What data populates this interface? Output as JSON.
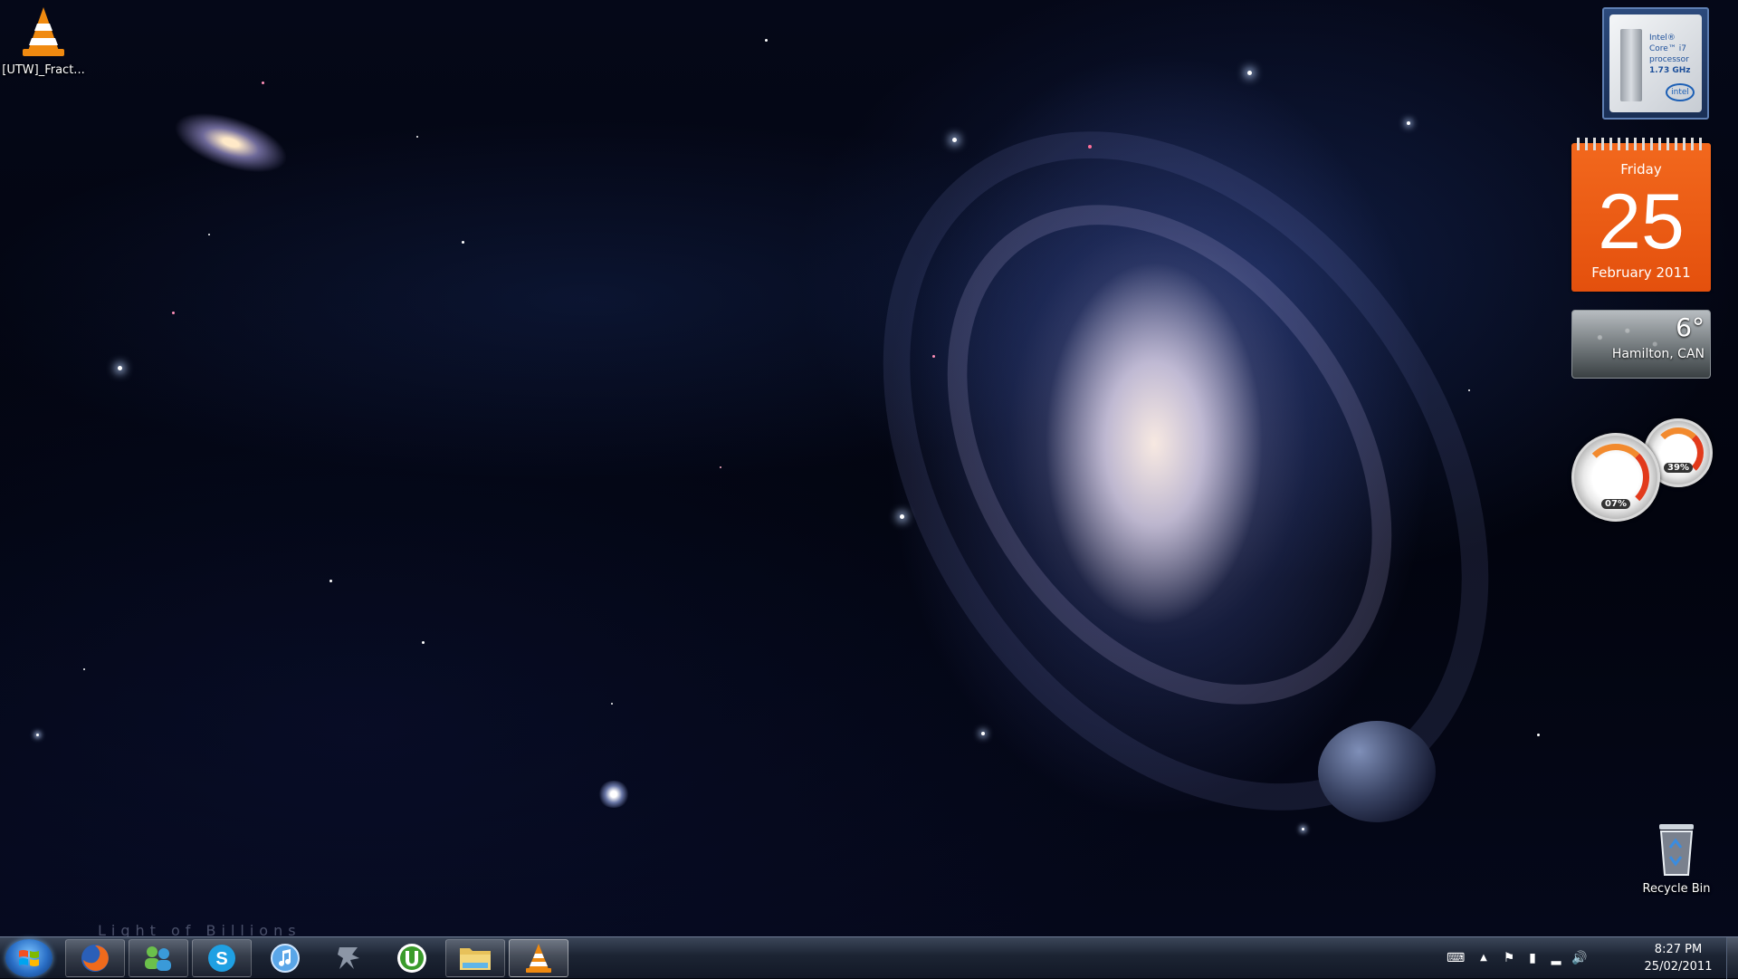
{
  "desktop": {
    "icons": [
      {
        "label": "[UTW]_Fract..."
      },
      {
        "label": "Recycle Bin"
      }
    ],
    "wallpaper_caption": "Light of Billions"
  },
  "gadgets": {
    "cpu": {
      "line1": "Intel®",
      "line2": "Core™ i7",
      "line3": "processor",
      "speed": "1.73 GHz",
      "brand": "intel"
    },
    "calendar": {
      "day_of_week": "Friday",
      "day": "25",
      "month_year": "February 2011"
    },
    "weather": {
      "temperature": "6°",
      "location": "Hamilton, CAN"
    },
    "meters": {
      "cpu_percent": "07%",
      "memory_percent": "39%"
    }
  },
  "taskbar": {
    "pinned": [
      "firefox-icon",
      "messenger-icon",
      "skype-icon",
      "itunes-icon",
      "starcraft-icon",
      "utorrent-icon",
      "explorer-icon",
      "vlc-icon"
    ],
    "clock": {
      "time": "8:27 PM",
      "date": "25/02/2011"
    }
  },
  "colors": {
    "calendar_orange": "#e85a14",
    "taskbar_dark": "#1c2433",
    "accent_blue": "#2a6fc6"
  }
}
